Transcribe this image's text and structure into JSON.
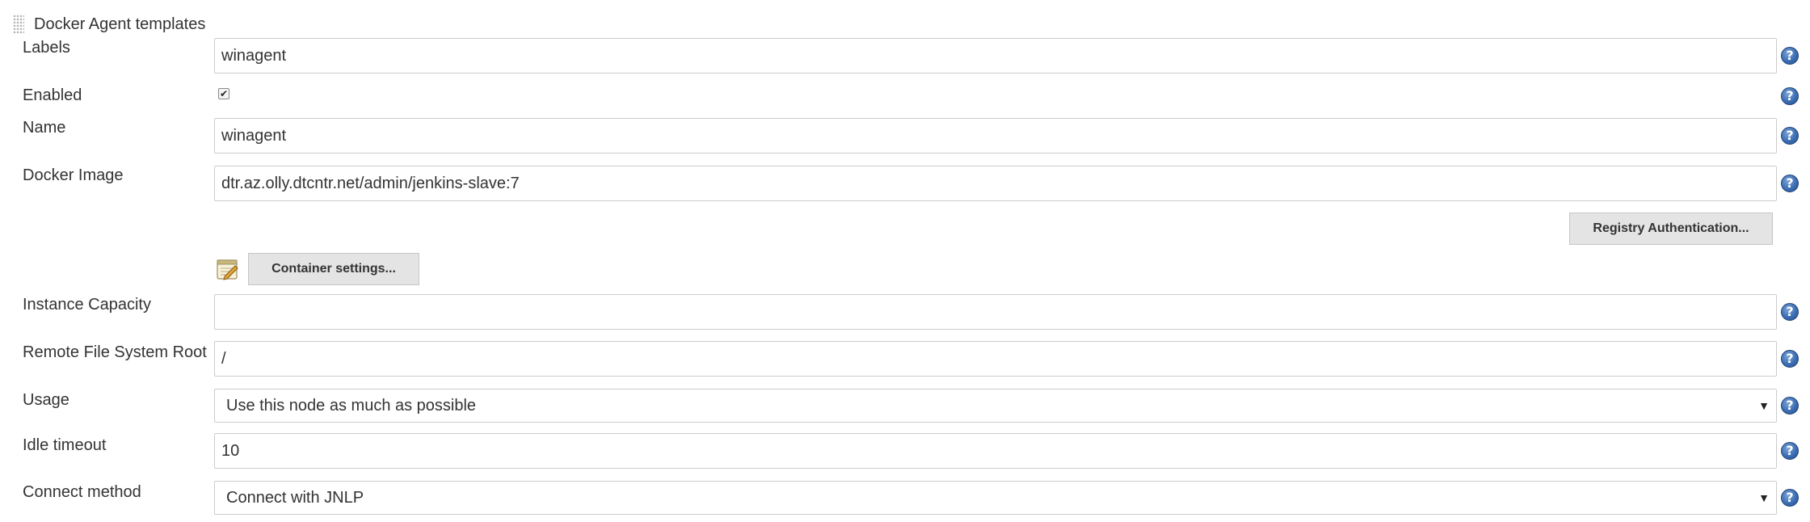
{
  "section": {
    "title": "Docker Agent templates"
  },
  "fields": {
    "labels": {
      "label": "Labels",
      "value": "winagent"
    },
    "enabled": {
      "label": "Enabled",
      "checked": true
    },
    "name": {
      "label": "Name",
      "value": "winagent"
    },
    "docker_image": {
      "label": "Docker Image",
      "value": "dtr.az.olly.dtcntr.net/admin/jenkins-slave:7"
    },
    "instance_capacity": {
      "label": "Instance Capacity",
      "value": ""
    },
    "remote_fs_root": {
      "label": "Remote File System Root",
      "value": "/"
    },
    "usage": {
      "label": "Usage",
      "value": "Use this node as much as possible"
    },
    "idle_timeout": {
      "label": "Idle timeout",
      "value": "10"
    },
    "connect_method": {
      "label": "Connect method",
      "value": "Connect with JNLP"
    }
  },
  "buttons": {
    "registry_auth": "Registry Authentication...",
    "container_settings": "Container settings..."
  },
  "icons": {
    "help": "?",
    "checkmark": "✔",
    "dropdown": "▼"
  },
  "colors": {
    "help_icon": "#3c6eb4",
    "button_bg": "#e4e4e4",
    "input_border": "#cccccc"
  }
}
